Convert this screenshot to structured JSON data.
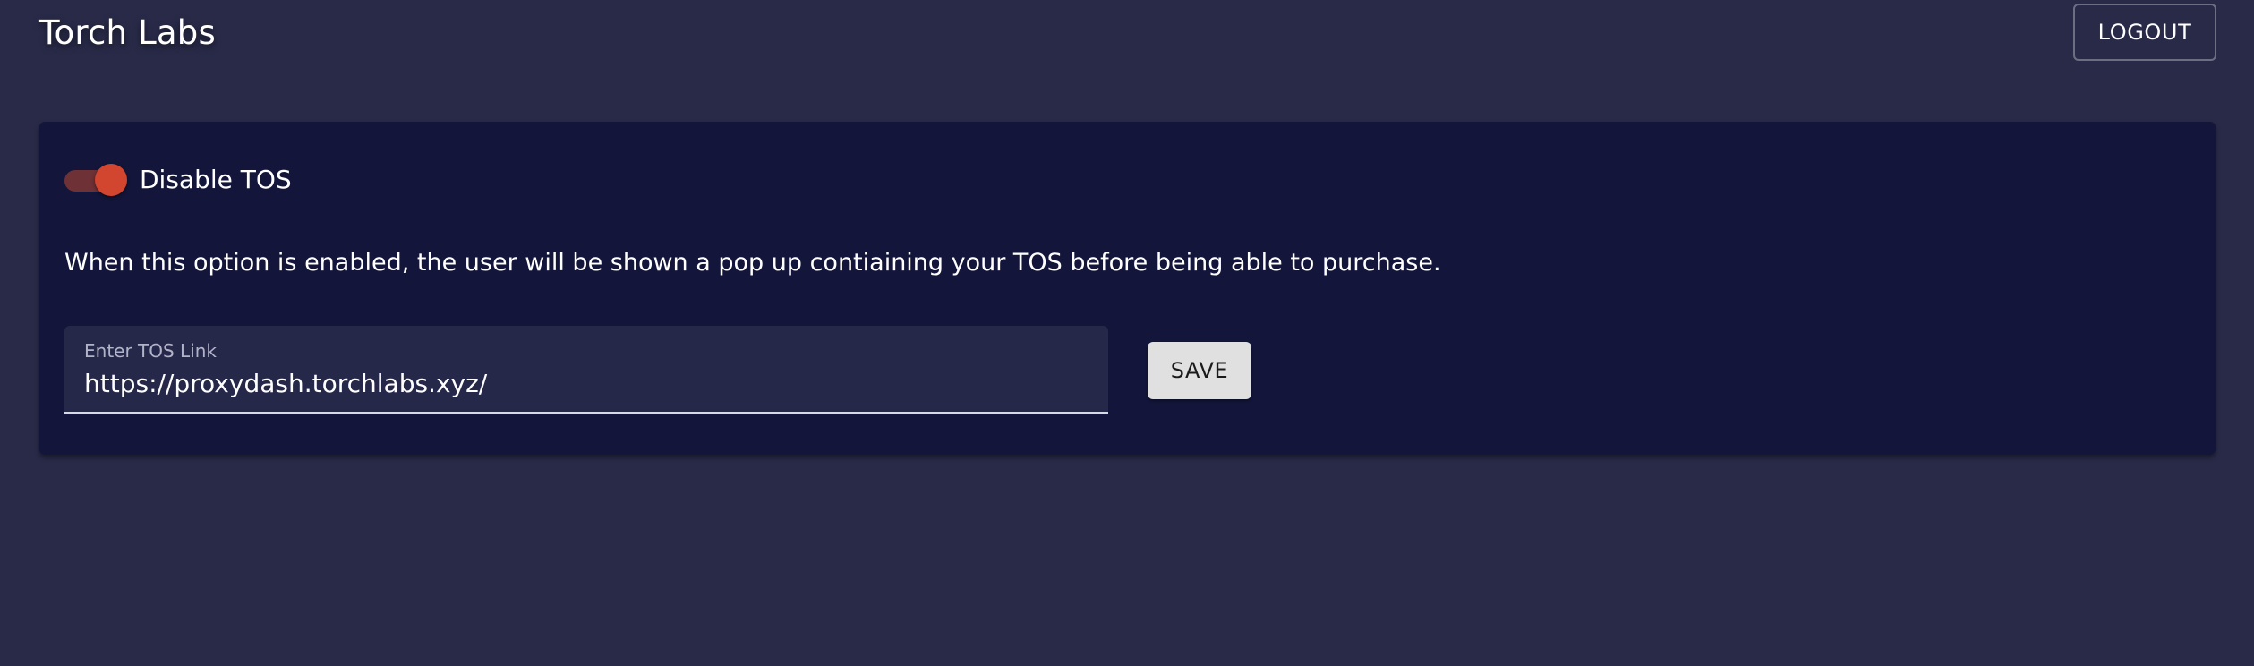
{
  "header": {
    "brand": "Torch Labs",
    "logout_label": "LOGOUT"
  },
  "tos_card": {
    "toggle": {
      "label": "Disable TOS",
      "checked": true,
      "accent_color": "#d2452f"
    },
    "description": "When this option is enabled, the user will be shown a pop up contiaining your TOS before being able to purchase.",
    "link_field": {
      "label": "Enter TOS Link",
      "value": "https://proxydash.torchlabs.xyz/"
    },
    "save_label": "SAVE"
  },
  "colors": {
    "page_background": "#282a48",
    "card_background": "#13163a",
    "field_background": "#26284a"
  }
}
